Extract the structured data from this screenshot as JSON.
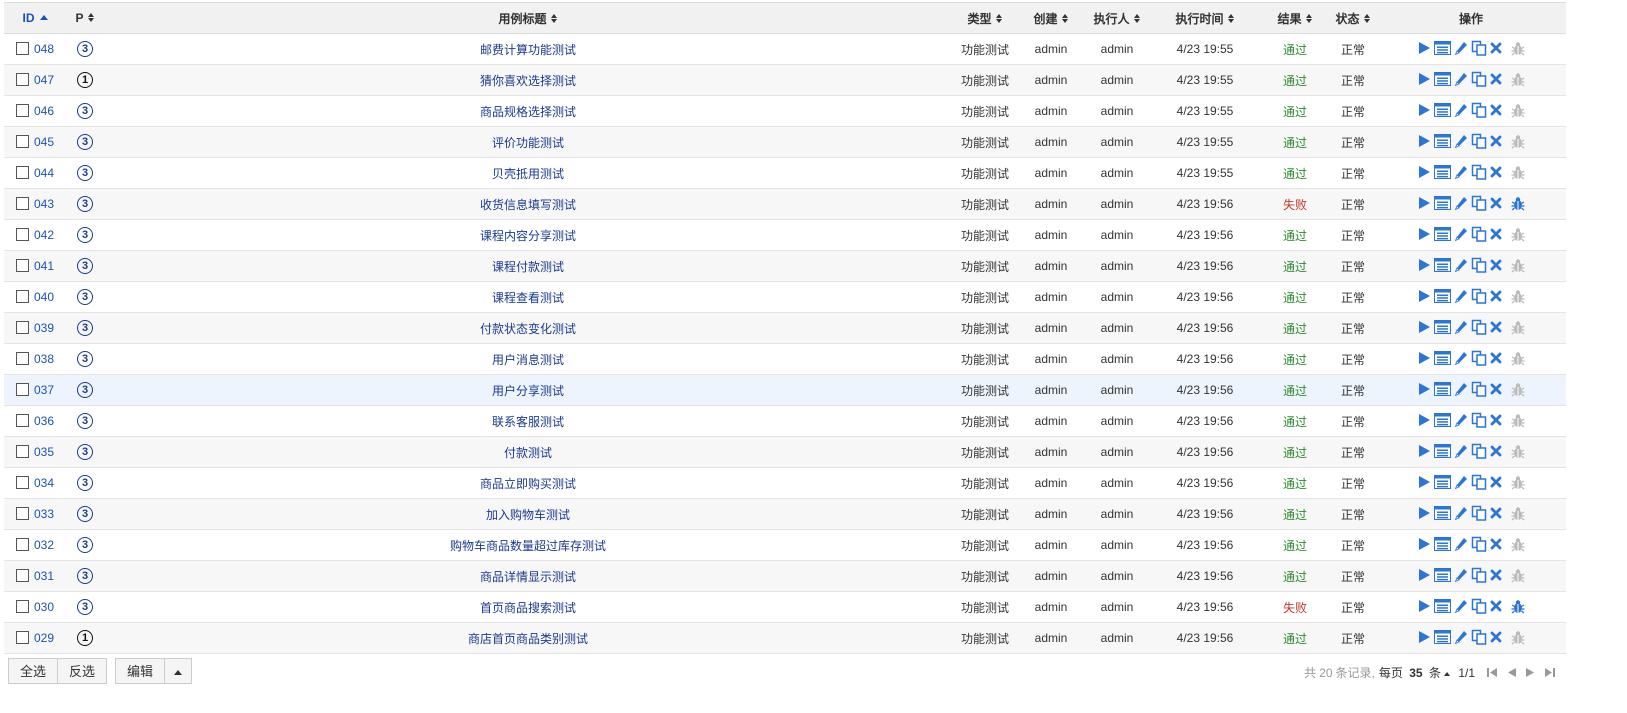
{
  "columns": {
    "id": "ID",
    "p": "P",
    "title": "用例标题",
    "type": "类型",
    "creator": "创建",
    "executor": "执行人",
    "exec_time": "执行时间",
    "result": "结果",
    "status": "状态",
    "actions": "操作"
  },
  "rows": [
    {
      "id": "048",
      "p": "3",
      "title": "邮费计算功能测试",
      "type": "功能测试",
      "creator": "admin",
      "executor": "admin",
      "time": "4/23 19:55",
      "result": "通过",
      "status": "正常",
      "highlight": false
    },
    {
      "id": "047",
      "p": "1",
      "title": "猜你喜欢选择测试",
      "type": "功能测试",
      "creator": "admin",
      "executor": "admin",
      "time": "4/23 19:55",
      "result": "通过",
      "status": "正常",
      "highlight": false
    },
    {
      "id": "046",
      "p": "3",
      "title": "商品规格选择测试",
      "type": "功能测试",
      "creator": "admin",
      "executor": "admin",
      "time": "4/23 19:55",
      "result": "通过",
      "status": "正常",
      "highlight": false
    },
    {
      "id": "045",
      "p": "3",
      "title": "评价功能测试",
      "type": "功能测试",
      "creator": "admin",
      "executor": "admin",
      "time": "4/23 19:55",
      "result": "通过",
      "status": "正常",
      "highlight": false
    },
    {
      "id": "044",
      "p": "3",
      "title": "贝壳抵用测试",
      "type": "功能测试",
      "creator": "admin",
      "executor": "admin",
      "time": "4/23 19:55",
      "result": "通过",
      "status": "正常",
      "highlight": false
    },
    {
      "id": "043",
      "p": "3",
      "title": "收货信息填写测试",
      "type": "功能测试",
      "creator": "admin",
      "executor": "admin",
      "time": "4/23 19:56",
      "result": "失败",
      "status": "正常",
      "highlight": false
    },
    {
      "id": "042",
      "p": "3",
      "title": "课程内容分享测试",
      "type": "功能测试",
      "creator": "admin",
      "executor": "admin",
      "time": "4/23 19:56",
      "result": "通过",
      "status": "正常",
      "highlight": false
    },
    {
      "id": "041",
      "p": "3",
      "title": "课程付款测试",
      "type": "功能测试",
      "creator": "admin",
      "executor": "admin",
      "time": "4/23 19:56",
      "result": "通过",
      "status": "正常",
      "highlight": false
    },
    {
      "id": "040",
      "p": "3",
      "title": "课程查看测试",
      "type": "功能测试",
      "creator": "admin",
      "executor": "admin",
      "time": "4/23 19:56",
      "result": "通过",
      "status": "正常",
      "highlight": false
    },
    {
      "id": "039",
      "p": "3",
      "title": "付款状态变化测试",
      "type": "功能测试",
      "creator": "admin",
      "executor": "admin",
      "time": "4/23 19:56",
      "result": "通过",
      "status": "正常",
      "highlight": false
    },
    {
      "id": "038",
      "p": "3",
      "title": "用户消息测试",
      "type": "功能测试",
      "creator": "admin",
      "executor": "admin",
      "time": "4/23 19:56",
      "result": "通过",
      "status": "正常",
      "highlight": false
    },
    {
      "id": "037",
      "p": "3",
      "title": "用户分享测试",
      "type": "功能测试",
      "creator": "admin",
      "executor": "admin",
      "time": "4/23 19:56",
      "result": "通过",
      "status": "正常",
      "highlight": true
    },
    {
      "id": "036",
      "p": "3",
      "title": "联系客服测试",
      "type": "功能测试",
      "creator": "admin",
      "executor": "admin",
      "time": "4/23 19:56",
      "result": "通过",
      "status": "正常",
      "highlight": false
    },
    {
      "id": "035",
      "p": "3",
      "title": "付款测试",
      "type": "功能测试",
      "creator": "admin",
      "executor": "admin",
      "time": "4/23 19:56",
      "result": "通过",
      "status": "正常",
      "highlight": false
    },
    {
      "id": "034",
      "p": "3",
      "title": "商品立即购买测试",
      "type": "功能测试",
      "creator": "admin",
      "executor": "admin",
      "time": "4/23 19:56",
      "result": "通过",
      "status": "正常",
      "highlight": false
    },
    {
      "id": "033",
      "p": "3",
      "title": "加入购物车测试",
      "type": "功能测试",
      "creator": "admin",
      "executor": "admin",
      "time": "4/23 19:56",
      "result": "通过",
      "status": "正常",
      "highlight": false
    },
    {
      "id": "032",
      "p": "3",
      "title": "购物车商品数量超过库存测试",
      "type": "功能测试",
      "creator": "admin",
      "executor": "admin",
      "time": "4/23 19:56",
      "result": "通过",
      "status": "正常",
      "highlight": false
    },
    {
      "id": "031",
      "p": "3",
      "title": "商品详情显示测试",
      "type": "功能测试",
      "creator": "admin",
      "executor": "admin",
      "time": "4/23 19:56",
      "result": "通过",
      "status": "正常",
      "highlight": false
    },
    {
      "id": "030",
      "p": "3",
      "title": "首页商品搜索测试",
      "type": "功能测试",
      "creator": "admin",
      "executor": "admin",
      "time": "4/23 19:56",
      "result": "失败",
      "status": "正常",
      "highlight": false
    },
    {
      "id": "029",
      "p": "1",
      "title": "商店首页商品类别测试",
      "type": "功能测试",
      "creator": "admin",
      "executor": "admin",
      "time": "4/23 19:56",
      "result": "通过",
      "status": "正常",
      "highlight": false
    }
  ],
  "footer": {
    "select_all": "全选",
    "invert": "反选",
    "edit": "编辑"
  },
  "pager": {
    "total_prefix": "共",
    "total": "20",
    "total_suffix": "条记录,",
    "per_page_prefix": "每页",
    "per_page": "35",
    "per_page_suffix": "条",
    "page": "1/1"
  },
  "colors": {
    "link": "#1a53b5",
    "pass": "#2e8b2e",
    "fail": "#c0392b",
    "icon_blue": "#2a75d6",
    "icon_gray": "#bbbbbb"
  },
  "icons": [
    "checkbox-icon",
    "priority-icon",
    "run-icon",
    "results-icon",
    "edit-icon",
    "copy-icon",
    "delete-icon",
    "bug-icon"
  ]
}
